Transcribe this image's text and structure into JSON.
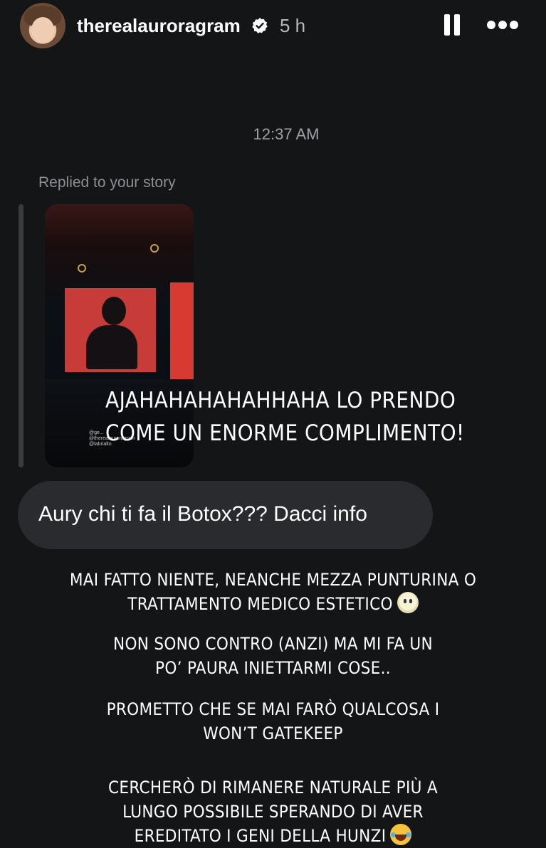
{
  "header": {
    "username": "therealauroragram",
    "verified_icon": "verified-badge-icon",
    "time_ago": "5 h",
    "pause_icon": "pause-icon",
    "more_icon": "more-dots-icon"
  },
  "conversation": {
    "timestamp": "12:37 AM",
    "replied_label": "Replied to your story",
    "story_tags": "@ge...\n@therealauroragram\n@labrialto",
    "story_caption": "AJAHAHAHAHAHHAHA LO PRENDO\nCOME UN ENORME COMPLIMENTO!",
    "message": "Aury chi ti fa il Botox??? Dacci info"
  },
  "response": {
    "para1": "MAI FATTO NIENTE, NEANCHE MEZZA PUNTURINA O\nTRATTAMENTO MEDICO ESTETICO",
    "para2": "NON SONO CONTRO (ANZI) MA MI FA UN\nPO’ PAURA INIETTARMI COSE..",
    "para3": "PROMETTO CHE SE MAI FARÒ QUALCOSA I\nWON’T GATEKEEP",
    "para4": "CERCHERÒ DI RIMANERE NATURALE PIÙ A\nLUNGO POSSIBILE SPERANDO DI AVER\nEREDITATO I GENI DELLA HUNZI"
  }
}
